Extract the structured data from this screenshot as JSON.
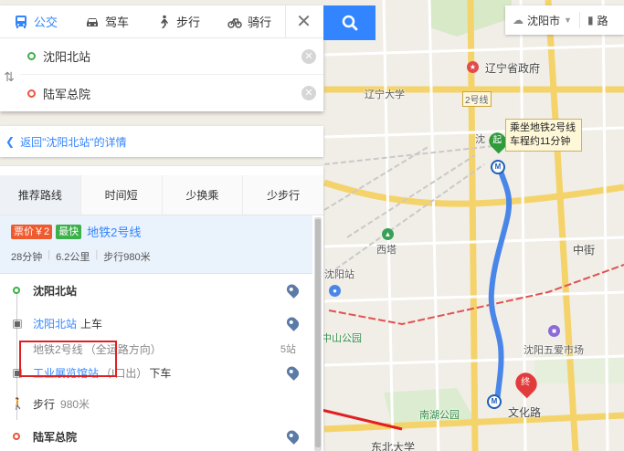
{
  "map": {
    "labels": {
      "liaoning_gov": "辽宁省政府",
      "liaoning_univ": "辽宁大学",
      "line2_tag": "2号线",
      "xita": "西塔",
      "shenyang_station": "沈阳站",
      "zhongjie": "中街",
      "zhongshan_park": "中山公园",
      "shenyang_wuai": "沈阳五爱市场",
      "nanhu_park": "南湖公园",
      "wenhua_road": "文化路",
      "neu": "东北大学",
      "shen_partial": "沈"
    },
    "callout": {
      "line1": "乘坐地铁2号线",
      "line2": "车程约11分钟"
    },
    "start_pin": "起",
    "end_pin": "终",
    "colors": {
      "route": "#4a86e8",
      "annotation": "#e02020",
      "metro_line": "#e05252"
    }
  },
  "city_bar": {
    "city": "沈阳市",
    "road": "路"
  },
  "search": {
    "tabs": [
      {
        "label": "公交",
        "icon": "bus-icon"
      },
      {
        "label": "驾车",
        "icon": "car-icon"
      },
      {
        "label": "步行",
        "icon": "walk-icon"
      },
      {
        "label": "骑行",
        "icon": "bike-icon"
      }
    ],
    "start": "沈阳北站",
    "end": "陆军总院"
  },
  "back_link": "返回\"沈阳北站\"的详情",
  "pref_tabs": [
    "推荐路线",
    "时间短",
    "少换乘",
    "少步行"
  ],
  "plan": {
    "price_badge": "票价￥2",
    "fast_badge": "最快",
    "line": "地铁2号线",
    "duration": "28分钟",
    "distance": "6.2公里",
    "walk": "步行980米"
  },
  "steps": {
    "origin": "沈阳北站",
    "board_station": "沈阳北站",
    "board_action": "上车",
    "ride_line": "地铁2号线",
    "ride_direction": "（全运路方向）",
    "ride_stops": "5站",
    "alight_station": "工业展览馆站",
    "alight_exit": "（I口出）",
    "alight_action": "下车",
    "walk_label": "步行",
    "walk_distance": "980米",
    "destination": "陆军总院"
  }
}
